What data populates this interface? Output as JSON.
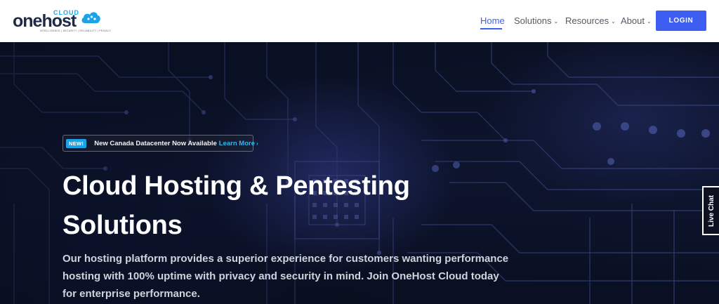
{
  "brand": {
    "name_main": "onehost",
    "name_super": "CLOUD",
    "tagline": "INTELLIGENCE | SECURITY | RELIABILITY | PRIVACY",
    "logo_icon": "cloud-icon",
    "accent_color": "#1aa3e8"
  },
  "nav": {
    "items": [
      {
        "label": "Home",
        "active": true,
        "has_dropdown": false
      },
      {
        "label": "Solutions",
        "active": false,
        "has_dropdown": true
      },
      {
        "label": "Resources",
        "active": false,
        "has_dropdown": true
      },
      {
        "label": "About",
        "active": false,
        "has_dropdown": true
      }
    ],
    "login_label": "LOGIN",
    "primary_color": "#3d5ef0"
  },
  "hero": {
    "badge": "NEW!",
    "announcement": "New Canada Datacenter Now Available",
    "announcement_link": "Learn More",
    "title_line1": "Cloud Hosting & Pentesting",
    "title_line2": "Solutions",
    "description": "Our hosting platform provides a superior experience for customers wanting performance hosting with 100% uptime with privacy and security in mind. Join OneHost Cloud today for enterprise performance."
  },
  "live_chat": {
    "label": "Live Chat"
  }
}
